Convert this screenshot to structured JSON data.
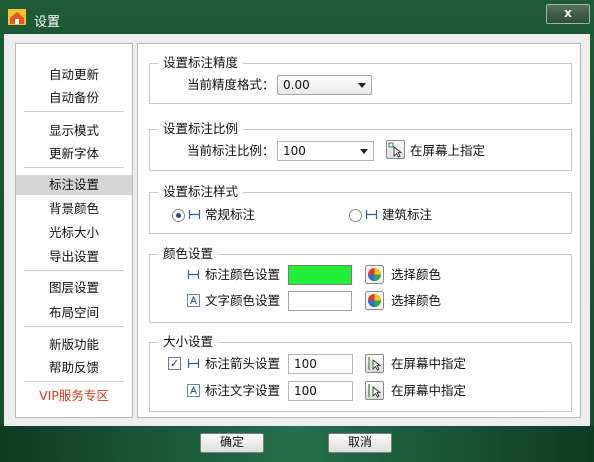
{
  "window": {
    "title": "设置",
    "close_label": "x"
  },
  "sidebar": {
    "items": [
      {
        "label": "自动更新"
      },
      {
        "label": "自动备份"
      },
      {
        "label": "显示模式"
      },
      {
        "label": "更新字体"
      },
      {
        "label": "标注设置"
      },
      {
        "label": "背景颜色"
      },
      {
        "label": "光标大小"
      },
      {
        "label": "导出设置"
      },
      {
        "label": "图层设置"
      },
      {
        "label": "布局空间"
      },
      {
        "label": "新版功能"
      },
      {
        "label": "帮助反馈"
      },
      {
        "label": "VIP服务专区"
      }
    ],
    "active": "标注设置"
  },
  "precision": {
    "title": "设置标注精度",
    "label": "当前精度格式：",
    "value": "0.00"
  },
  "scale": {
    "title": "设置标注比例",
    "label": "当前标注比例：",
    "value": "100",
    "pick_label": "在屏幕上指定"
  },
  "style": {
    "title": "设置标注样式",
    "normal_label": "常规标注",
    "arch_label": "建筑标注",
    "selected": "常规标注"
  },
  "colors": {
    "title": "颜色设置",
    "dim_label": "标注颜色设置",
    "dim_color": "#22ee3a",
    "text_label": "文字颜色设置",
    "text_color": "#ffffff",
    "choose_label": "选择颜色"
  },
  "size": {
    "title": "大小设置",
    "arrow_label": "标注箭头设置",
    "arrow_value": "100",
    "arrow_checked": true,
    "text_label": "标注文字设置",
    "text_value": "100",
    "pick_label": "在屏幕中指定"
  },
  "footer": {
    "ok_label": "确定",
    "cancel_label": "取消"
  }
}
